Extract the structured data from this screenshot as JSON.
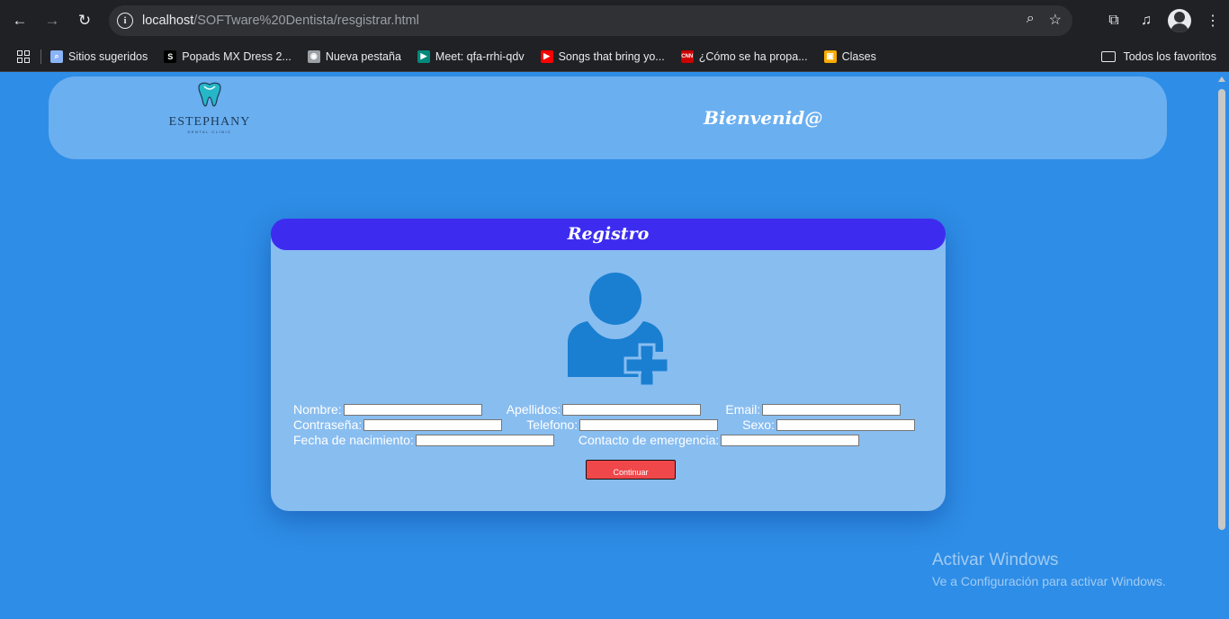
{
  "browser": {
    "url_host": "localhost",
    "url_path": "/SOFTware%20Dentista/resgistrar.html",
    "bookmarks": [
      {
        "label": "Sitios sugeridos",
        "icon": "search-icon",
        "color": "#8ab4f8"
      },
      {
        "label": "Popads MX Dress 2...",
        "icon": "s-logo-icon",
        "color": "#000000"
      },
      {
        "label": "Nueva pestaña",
        "icon": "globe-icon",
        "color": "#9aa0a6"
      },
      {
        "label": "Meet: qfa-rrhi-qdv",
        "icon": "meet-icon",
        "color": "#00897b"
      },
      {
        "label": "Songs that bring yo...",
        "icon": "youtube-icon",
        "color": "#ff0000"
      },
      {
        "label": "¿Cómo se ha propa...",
        "icon": "cnn-icon",
        "color": "#cc0000"
      },
      {
        "label": "Clases",
        "icon": "classroom-icon",
        "color": "#f9ab00"
      }
    ],
    "all_bookmarks": "Todos los favoritos"
  },
  "header": {
    "logo_text": "ESTEPHANY",
    "logo_sub": "DENTAL CLINIC",
    "welcome": "Bienvenid@"
  },
  "form": {
    "title": "Registro",
    "fields": {
      "nombre": "Nombre:",
      "apellidos": "Apellidos:",
      "email": "Email:",
      "contrasena": "Contraseña:",
      "telefono": "Telefono:",
      "sexo": "Sexo:",
      "fecha_nacimiento": "Fecha de nacimiento:",
      "contacto_emergencia": "Contacto de emergencia:"
    },
    "submit": "Continuar"
  },
  "watermark": {
    "title": "Activar Windows",
    "subtitle": "Ve a Configuración para activar Windows."
  },
  "colors": {
    "page_bg": "#2e8de6",
    "header_bg": "#6aaff0",
    "card_bg": "#88bdf0",
    "card_header": "#3d2cf0",
    "button": "#f0474a",
    "icon_blue": "#1a7fd0"
  }
}
